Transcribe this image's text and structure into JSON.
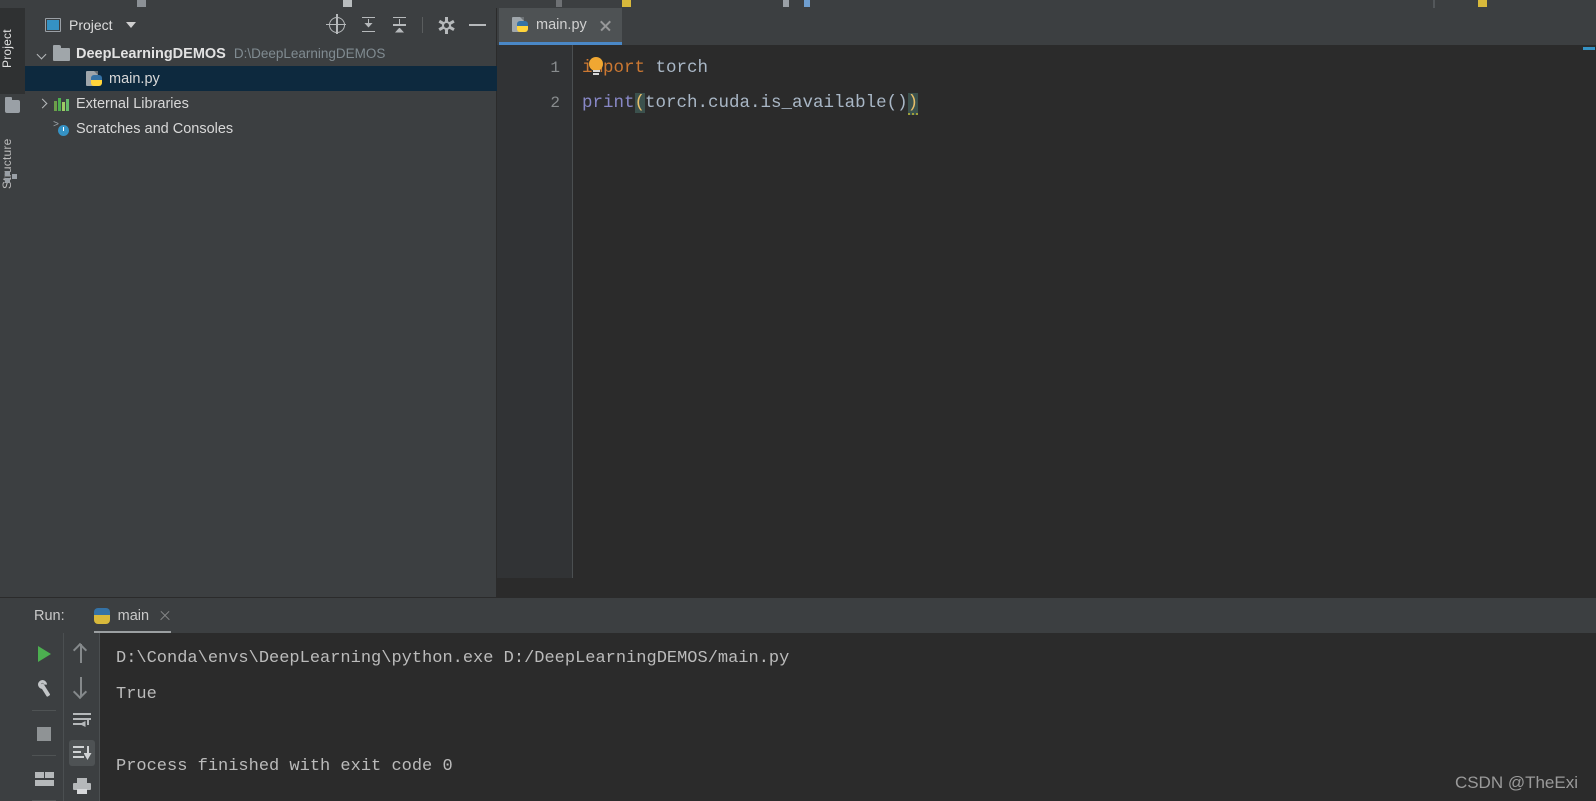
{
  "window": {
    "theme_bg": "#3c3f41",
    "editor_bg": "#2b2b2b",
    "accent": "#3592c4",
    "selection_bg": "#0d293e"
  },
  "left_tool_strip": {
    "tabs": [
      {
        "label": "Project",
        "icon": "folder-icon",
        "active": true
      },
      {
        "label": "Structure",
        "icon": "structure-icon",
        "active": false
      }
    ]
  },
  "project_panel": {
    "title": "Project",
    "title_icon": "project-icon",
    "dropdown_icon": "chevron-down-icon",
    "tools": [
      {
        "name": "locate-icon",
        "title": "Select Opened File"
      },
      {
        "name": "expand-all-icon",
        "title": "Expand All"
      },
      {
        "name": "collapse-all-icon",
        "title": "Collapse All"
      },
      {
        "name": "gear-icon",
        "title": "Settings"
      },
      {
        "name": "minimize-icon",
        "title": "Hide"
      }
    ],
    "tree": [
      {
        "label": "DeepLearningDEMOS",
        "path": "D:\\DeepLearningDEMOS",
        "icon": "folder-icon",
        "twisty": "expanded",
        "bold": true,
        "indent": 0,
        "selected": false
      },
      {
        "label": "main.py",
        "path": "",
        "icon": "python-file-icon",
        "twisty": "none",
        "bold": false,
        "indent": 1,
        "selected": true
      },
      {
        "label": "External Libraries",
        "path": "",
        "icon": "libraries-icon",
        "twisty": "collapsed",
        "bold": false,
        "indent": 0,
        "selected": false
      },
      {
        "label": "Scratches and Consoles",
        "path": "",
        "icon": "scratches-icon",
        "twisty": "none",
        "bold": false,
        "indent": 0,
        "selected": false
      }
    ]
  },
  "editor": {
    "tabs": [
      {
        "label": "main.py",
        "icon": "python-file-icon",
        "active": true,
        "close_icon": "close-icon"
      }
    ],
    "line_numbers": [
      "1",
      "2"
    ],
    "code": {
      "line1": {
        "keyword": "import",
        "space": " ",
        "module": "torch"
      },
      "line2": {
        "fn": "print",
        "open_paren": "(",
        "arg": "torch.cuda.is_available()",
        "close_paren": ")"
      }
    },
    "intention_icon": "lightbulb-icon"
  },
  "run_panel": {
    "label": "Run:",
    "tab": {
      "label": "main",
      "icon": "python-icon",
      "close_icon": "close-icon"
    },
    "toolbar_left": [
      {
        "name": "run-button",
        "icon": "play-icon"
      },
      {
        "name": "settings-button",
        "icon": "wrench-icon"
      },
      {
        "name": "stop-button",
        "icon": "stop-icon"
      },
      {
        "name": "layout-button",
        "icon": "layout-icon"
      }
    ],
    "toolbar_right": [
      {
        "name": "prev-occurrence-button",
        "icon": "arrow-up-icon"
      },
      {
        "name": "next-occurrence-button",
        "icon": "arrow-down-icon"
      },
      {
        "name": "soft-wrap-button",
        "icon": "soft-wrap-icon"
      },
      {
        "name": "scroll-to-end-button",
        "icon": "scroll-to-end-icon",
        "active": true
      },
      {
        "name": "print-button",
        "icon": "print-icon"
      }
    ],
    "console_lines": [
      "D:\\Conda\\envs\\DeepLearning\\python.exe D:/DeepLearningDEMOS/main.py",
      "True",
      "",
      "Process finished with exit code 0"
    ]
  },
  "watermark": "CSDN @TheExi"
}
